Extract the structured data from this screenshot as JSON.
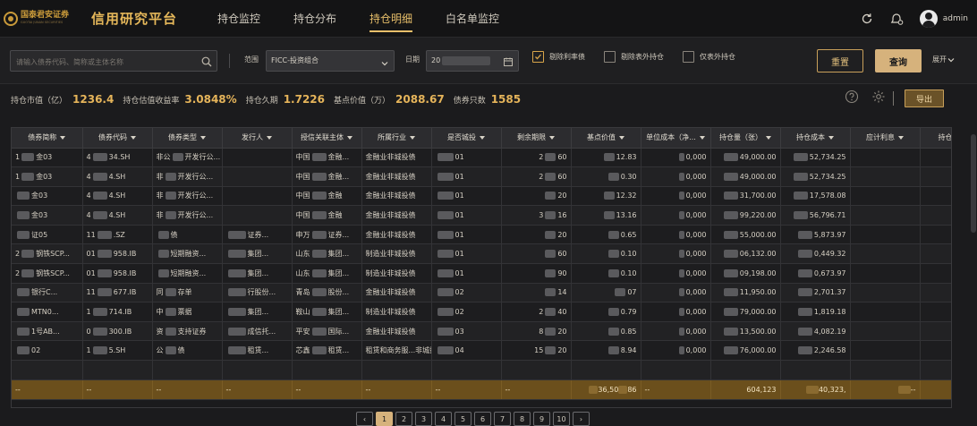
{
  "brand": {
    "logo_cn": "国泰君安证券",
    "logo_en": "GUOTAI JUNAN SECURITIES",
    "platform_title": "信用研究平台"
  },
  "nav": {
    "items": [
      "持仓监控",
      "持仓分布",
      "持仓明细",
      "白名单监控"
    ],
    "active_index": 2
  },
  "user": {
    "name": "admin"
  },
  "filters": {
    "search_placeholder": "请输入债券代码、简称或主体名称",
    "scope_label": "范围",
    "scope_value": "FICC-投资组合",
    "date_label": "日期",
    "date_prefix": "20",
    "checkboxes": [
      {
        "label": "剔除利率债",
        "checked": true
      },
      {
        "label": "剔除表外持仓",
        "checked": false
      },
      {
        "label": "仅表外持仓",
        "checked": false
      }
    ],
    "reset_label": "重置",
    "query_label": "查询",
    "expand_label": "展开"
  },
  "stats": {
    "items": [
      {
        "label": "持仓市值（亿）",
        "value": "1236.4"
      },
      {
        "label": "持仓估值收益率",
        "value": "3.0848%"
      },
      {
        "label": "持仓久期",
        "value": "1.7226"
      },
      {
        "label": "基点价值（万）",
        "value": "2088.67"
      },
      {
        "label": "债券只数",
        "value": "1585"
      }
    ],
    "export_label": "导出"
  },
  "table": {
    "columns": [
      "债券简称",
      "债券代码",
      "债券类型",
      "发行人",
      "授信关联主体",
      "所属行业",
      "是否城投",
      "剩余期限",
      "基点价值",
      "单位成本（净...",
      "持仓量（张）",
      "持仓成本",
      "应计利息",
      "持仓"
    ],
    "rows": [
      [
        "1",
        "金03",
        "4",
        "34.SH",
        "非公",
        "开发行公...",
        "",
        "",
        "中国",
        "金融...",
        "金融业",
        "非城投债",
        "",
        "01",
        "2",
        "60",
        "",
        "12.83",
        "",
        "0,000",
        "",
        "49,000.00",
        "",
        "52,734.25"
      ],
      [
        "1",
        "金03",
        "4",
        "4.SH",
        "非",
        "开发行公...",
        "",
        "",
        "中国",
        "金融...",
        "金融业",
        "非城投债",
        "",
        "01",
        "2",
        "60",
        "",
        "0.30",
        "",
        "0,000",
        "",
        "49,000.00",
        "",
        "52,734.25"
      ],
      [
        "",
        "金03",
        "4",
        "4.SH",
        "非",
        "开发行公...",
        "",
        "",
        "中国",
        "金融",
        "金融业",
        "非城投债",
        "",
        "01",
        "",
        "20",
        "",
        "12.32",
        "",
        "0,000",
        "",
        "31,700.00",
        "",
        "17,578.08"
      ],
      [
        "",
        "金03",
        "4",
        "4.SH",
        "非",
        "开发行公...",
        "",
        "",
        "中国",
        "金融",
        "金融业",
        "非城投债",
        "",
        "01",
        "3",
        "16",
        "",
        "13.16",
        "",
        "0,000",
        "",
        "99,220.00",
        "",
        "56,796.71"
      ],
      [
        "",
        "证05",
        "11",
        ".SZ",
        "",
        "债",
        "",
        "证券...",
        "申万",
        "证券...",
        "金融业",
        "非城投债",
        "",
        "01",
        "",
        "20",
        "",
        "0.65",
        "",
        "0,000",
        "",
        "55,000.00",
        "",
        "5,873.97"
      ],
      [
        "2",
        "钢铁SCP...",
        "01",
        "958.IB",
        "",
        "短期融资...",
        "",
        "集团...",
        "山东",
        "集团...",
        "制造业",
        "非城投债",
        "",
        "01",
        "",
        "60",
        "",
        "0.10",
        "",
        "0,000",
        "",
        "06,132.00",
        "",
        "0,449.32"
      ],
      [
        "2",
        "钢铁SCP...",
        "01",
        "958.IB",
        "",
        "短期融资...",
        "",
        "集团...",
        "山东",
        "集团...",
        "制造业",
        "非城投债",
        "",
        "01",
        "",
        "90",
        "",
        "0.10",
        "",
        "0,000",
        "",
        "09,198.00",
        "",
        "0,673.97"
      ],
      [
        "",
        "银行C...",
        "11",
        "677.IB",
        "同",
        "存单",
        "",
        "行股份...",
        "青岛",
        "股份...",
        "金融业",
        "非城投债",
        "",
        "02",
        "",
        "14",
        "",
        "07",
        "",
        "0,000",
        "",
        "11,950.00",
        "",
        "2,701.37"
      ],
      [
        "",
        "MTN0...",
        "1",
        "714.IB",
        "中",
        "票据",
        "",
        "集团...",
        "鞍山",
        "集团...",
        "制造业",
        "非城投债",
        "",
        "02",
        "2",
        "40",
        "",
        "0.79",
        "",
        "0,000",
        "",
        "79,000.00",
        "",
        "1,819.18"
      ],
      [
        "",
        "1号AB...",
        "0",
        "300.IB",
        "资",
        "支持证券",
        "",
        "成信托...",
        "平安",
        "国际...",
        "金融业",
        "非城投债",
        "",
        "03",
        "8",
        "20",
        "",
        "0.85",
        "",
        "0,000",
        "",
        "13,500.00",
        "",
        "4,082.19"
      ],
      [
        "",
        "02",
        "1",
        "5.SH",
        "公",
        "债",
        "",
        "租赁...",
        "芯鑫",
        "租赁...",
        "租赁和商务服...",
        "非城投债",
        "",
        "04",
        "15",
        "20",
        "",
        "8.94",
        "",
        "0,000",
        "",
        "76,000.00",
        "",
        "2,246.58"
      ],
      [
        "",
        "",
        "",
        "",
        "",
        "",
        "",
        "",
        "",
        "",
        "",
        "",
        "",
        "",
        "",
        "",
        "",
        "",
        "",
        "",
        "",
        "",
        "",
        ""
      ]
    ],
    "total_row": [
      "--",
      "--",
      "--",
      "--",
      "--",
      "--",
      "--",
      "--",
      "36,50",
      "86",
      "--",
      "604,123",
      "40,323,",
      "--"
    ]
  },
  "pagination": {
    "pages": [
      "1",
      "2",
      "3",
      "4",
      "5",
      "6",
      "7",
      "8",
      "9",
      "10"
    ],
    "active": "1",
    "prev": "‹",
    "next": "›"
  }
}
